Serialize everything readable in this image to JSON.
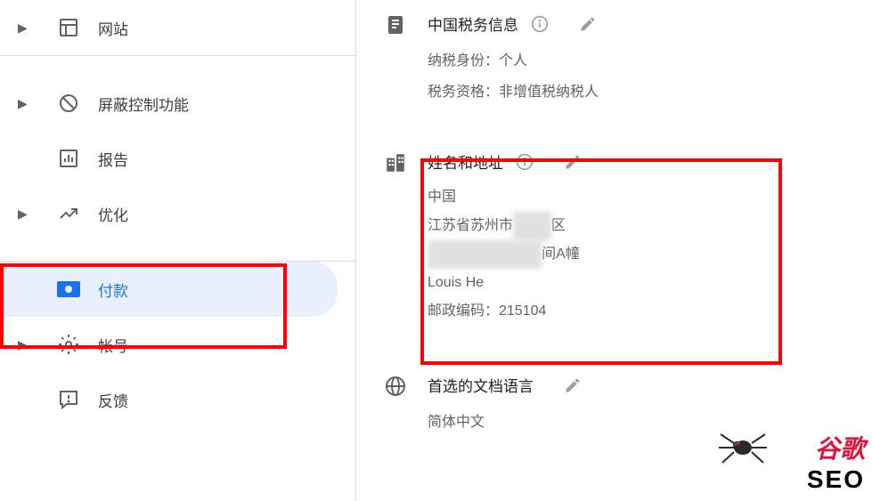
{
  "sidebar": {
    "items": [
      {
        "label": "网站",
        "icon": "web-icon",
        "expandable": true
      },
      {
        "label": "屏蔽控制功能",
        "icon": "block-icon",
        "expandable": true
      },
      {
        "label": "报告",
        "icon": "report-icon",
        "expandable": false
      },
      {
        "label": "优化",
        "icon": "optimize-icon",
        "expandable": true
      },
      {
        "label": "付款",
        "icon": "payment-icon",
        "expandable": false,
        "active": true
      },
      {
        "label": "帐号",
        "icon": "account-icon",
        "expandable": true
      },
      {
        "label": "反馈",
        "icon": "feedback-icon",
        "expandable": false
      }
    ]
  },
  "sections": {
    "tax": {
      "title": "中国税务信息",
      "rows": [
        {
          "key": "纳税身份",
          "value": "个人"
        },
        {
          "key": "税务资格",
          "value": "非增值税纳税人"
        }
      ]
    },
    "address": {
      "title": "姓名和地址",
      "lines": {
        "country": "中国",
        "province_prefix": "江苏省苏州市",
        "province_suffix": "区",
        "street_suffix": "间A幢",
        "name": "Louis He",
        "postal": "邮政编码：215104"
      }
    },
    "language": {
      "title": "首选的文档语言",
      "value": "简体中文"
    }
  },
  "watermark": {
    "cn": "谷歌",
    "seo": "SEO"
  }
}
